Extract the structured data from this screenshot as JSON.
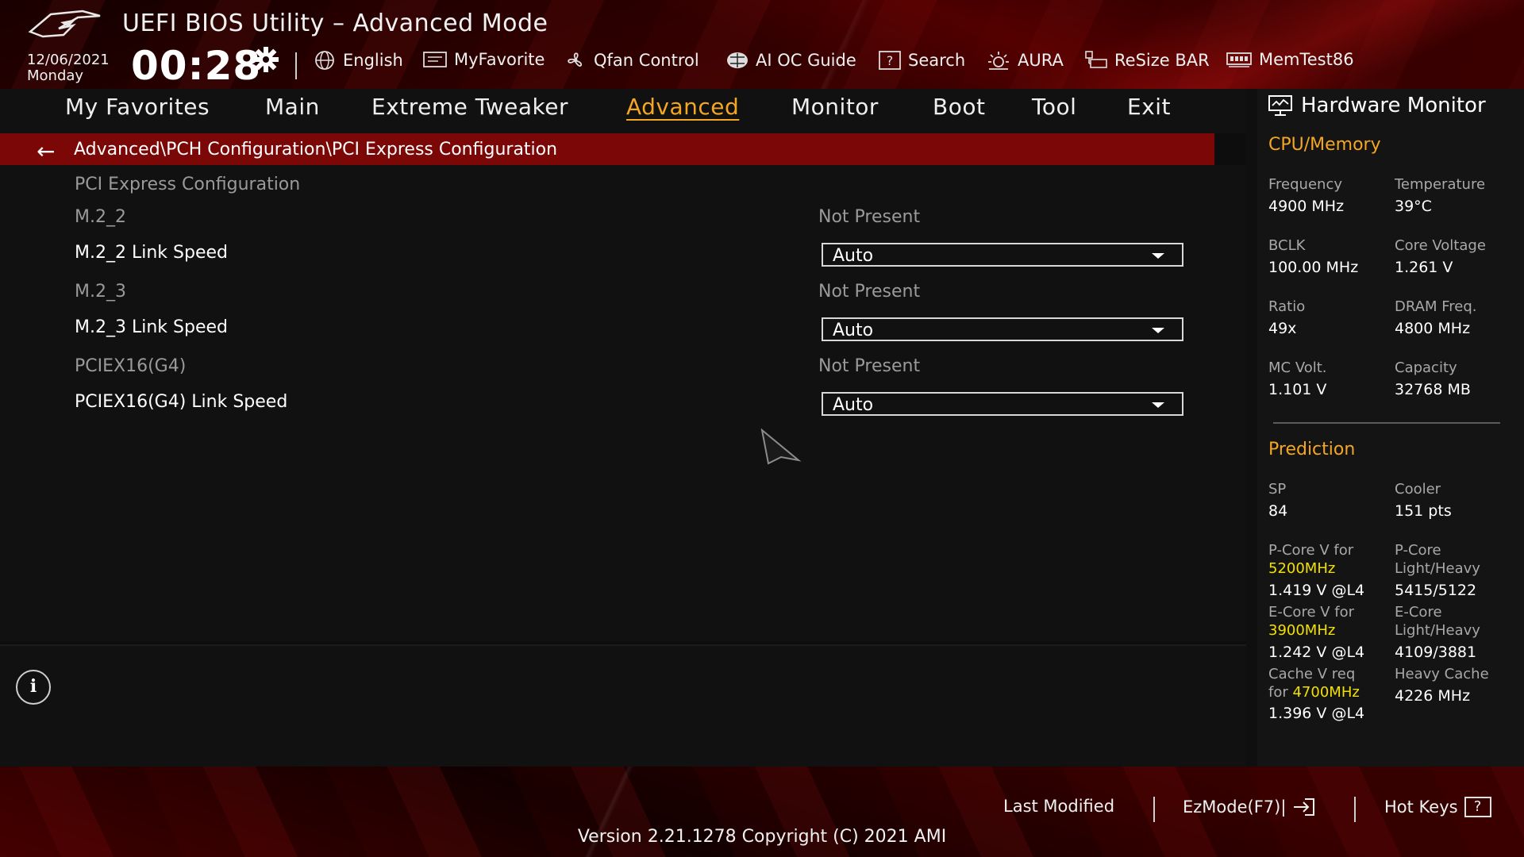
{
  "header": {
    "title": "UEFI BIOS Utility – Advanced Mode",
    "date": "12/06/2021",
    "weekday": "Monday",
    "time": "00:28"
  },
  "toolbar": {
    "items": [
      {
        "label": "English",
        "icon": "globe-icon"
      },
      {
        "label": "MyFavorite",
        "icon": "favorite-icon"
      },
      {
        "label": "Qfan Control",
        "icon": "fan-icon"
      },
      {
        "label": "AI OC Guide",
        "icon": "ai-oc-icon"
      },
      {
        "label": "Search",
        "icon": "search-icon"
      },
      {
        "label": "AURA",
        "icon": "aura-icon"
      },
      {
        "label": "ReSize BAR",
        "icon": "resize-bar-icon"
      },
      {
        "label": "MemTest86",
        "icon": "memtest-icon"
      }
    ]
  },
  "tabs": [
    "My Favorites",
    "Main",
    "Extreme Tweaker",
    "Advanced",
    "Monitor",
    "Boot",
    "Tool",
    "Exit"
  ],
  "active_tab": "Advanced",
  "breadcrumb": "Advanced\\PCH Configuration\\PCI Express Configuration",
  "settings": {
    "section_title": "PCI Express Configuration",
    "rows": [
      {
        "label": "M.2_2",
        "value": "Not Present"
      },
      {
        "label": "M.2_2 Link Speed",
        "selected": "Auto"
      },
      {
        "label": "M.2_3",
        "value": "Not Present"
      },
      {
        "label": "M.2_3 Link Speed",
        "selected": "Auto"
      },
      {
        "label": "PCIEX16(G4)",
        "value": "Not Present"
      },
      {
        "label": "PCIEX16(G4) Link Speed",
        "selected": "Auto"
      }
    ]
  },
  "hardware_monitor": {
    "title": "Hardware Monitor",
    "cpu_memory": {
      "heading": "CPU/Memory",
      "frequency_label": "Frequency",
      "frequency": "4900 MHz",
      "temperature_label": "Temperature",
      "temperature": "39°C",
      "bclk_label": "BCLK",
      "bclk": "100.00 MHz",
      "core_voltage_label": "Core Voltage",
      "core_voltage": "1.261 V",
      "ratio_label": "Ratio",
      "ratio": "49x",
      "dram_freq_label": "DRAM Freq.",
      "dram_freq": "4800 MHz",
      "mc_volt_label": "MC Volt.",
      "mc_volt": "1.101 V",
      "capacity_label": "Capacity",
      "capacity": "32768 MB"
    },
    "prediction": {
      "heading": "Prediction",
      "sp_label": "SP",
      "sp": "84",
      "cooler_label": "Cooler",
      "cooler": "151 pts",
      "pcore_v_label": "P-Core V for",
      "pcore_freq": "5200MHz",
      "pcore_v": "1.419 V @L4",
      "pcore_lh_label_1": "P-Core",
      "pcore_lh_label_2": "Light/Heavy",
      "pcore_lh": "5415/5122",
      "ecore_v_label": "E-Core V for",
      "ecore_freq": "3900MHz",
      "ecore_v": "1.242 V @L4",
      "ecore_lh_label_1": "E-Core",
      "ecore_lh_label_2": "Light/Heavy",
      "ecore_lh": "4109/3881",
      "cache_v_label_1": "Cache V req",
      "cache_v_label_2": "for",
      "cache_freq": "4700MHz",
      "cache_v": "1.396 V @L4",
      "heavy_cache_label": "Heavy Cache",
      "heavy_cache": "4226 MHz"
    }
  },
  "footer": {
    "last_modified": "Last Modified",
    "ezmode": "EzMode(F7)|",
    "hot_keys": "Hot Keys",
    "hot_keys_key": "?",
    "version": "Version 2.21.1278 Copyright (C) 2021 AMI"
  },
  "colors": {
    "accent": "#f5a623",
    "breadcrumb_bg": "#7b0707",
    "highlight_freq": "#f2e000"
  }
}
